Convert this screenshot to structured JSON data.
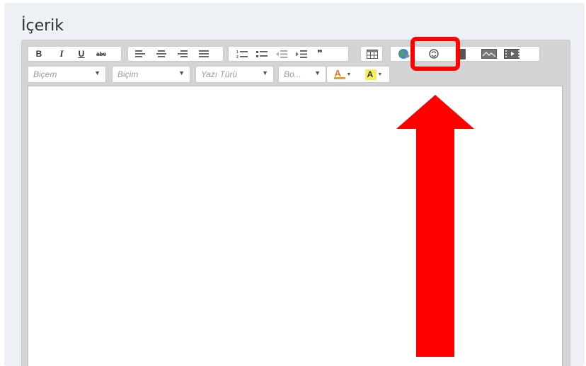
{
  "section": {
    "title": "İçerik"
  },
  "toolbar": {
    "bold_label": "B",
    "italic_label": "I",
    "underline_label": "U",
    "strike_label": "abc",
    "quote_label": "❞",
    "format_combos": [
      {
        "value": "Biçem"
      },
      {
        "value": "Biçim"
      },
      {
        "value": "Yazı Türü"
      },
      {
        "value": "Bo..."
      }
    ],
    "text_color_label": "A",
    "bg_color_label": "A"
  },
  "icons": {
    "bold": "bold-icon",
    "italic": "italic-icon",
    "underline": "underline-icon",
    "strike": "strikethrough-icon",
    "align_left": "align-left-icon",
    "align_center": "align-center-icon",
    "align_right": "align-right-icon",
    "justify": "align-justify-icon",
    "numbered_list": "numbered-list-icon",
    "bullet_list": "bullet-list-icon",
    "outdent": "outdent-icon",
    "indent": "indent-icon",
    "blockquote": "blockquote-icon",
    "table": "table-icon",
    "link": "link-globe-icon",
    "unlink": "unlink-icon",
    "anchor": "anchor-icon",
    "image": "image-icon",
    "video": "video-icon"
  },
  "colors": {
    "highlight": "#ff0000",
    "arrow": "#ff0000",
    "text_color_swatch": "#f0a020",
    "bg_color_swatch": "#f5f05a"
  }
}
